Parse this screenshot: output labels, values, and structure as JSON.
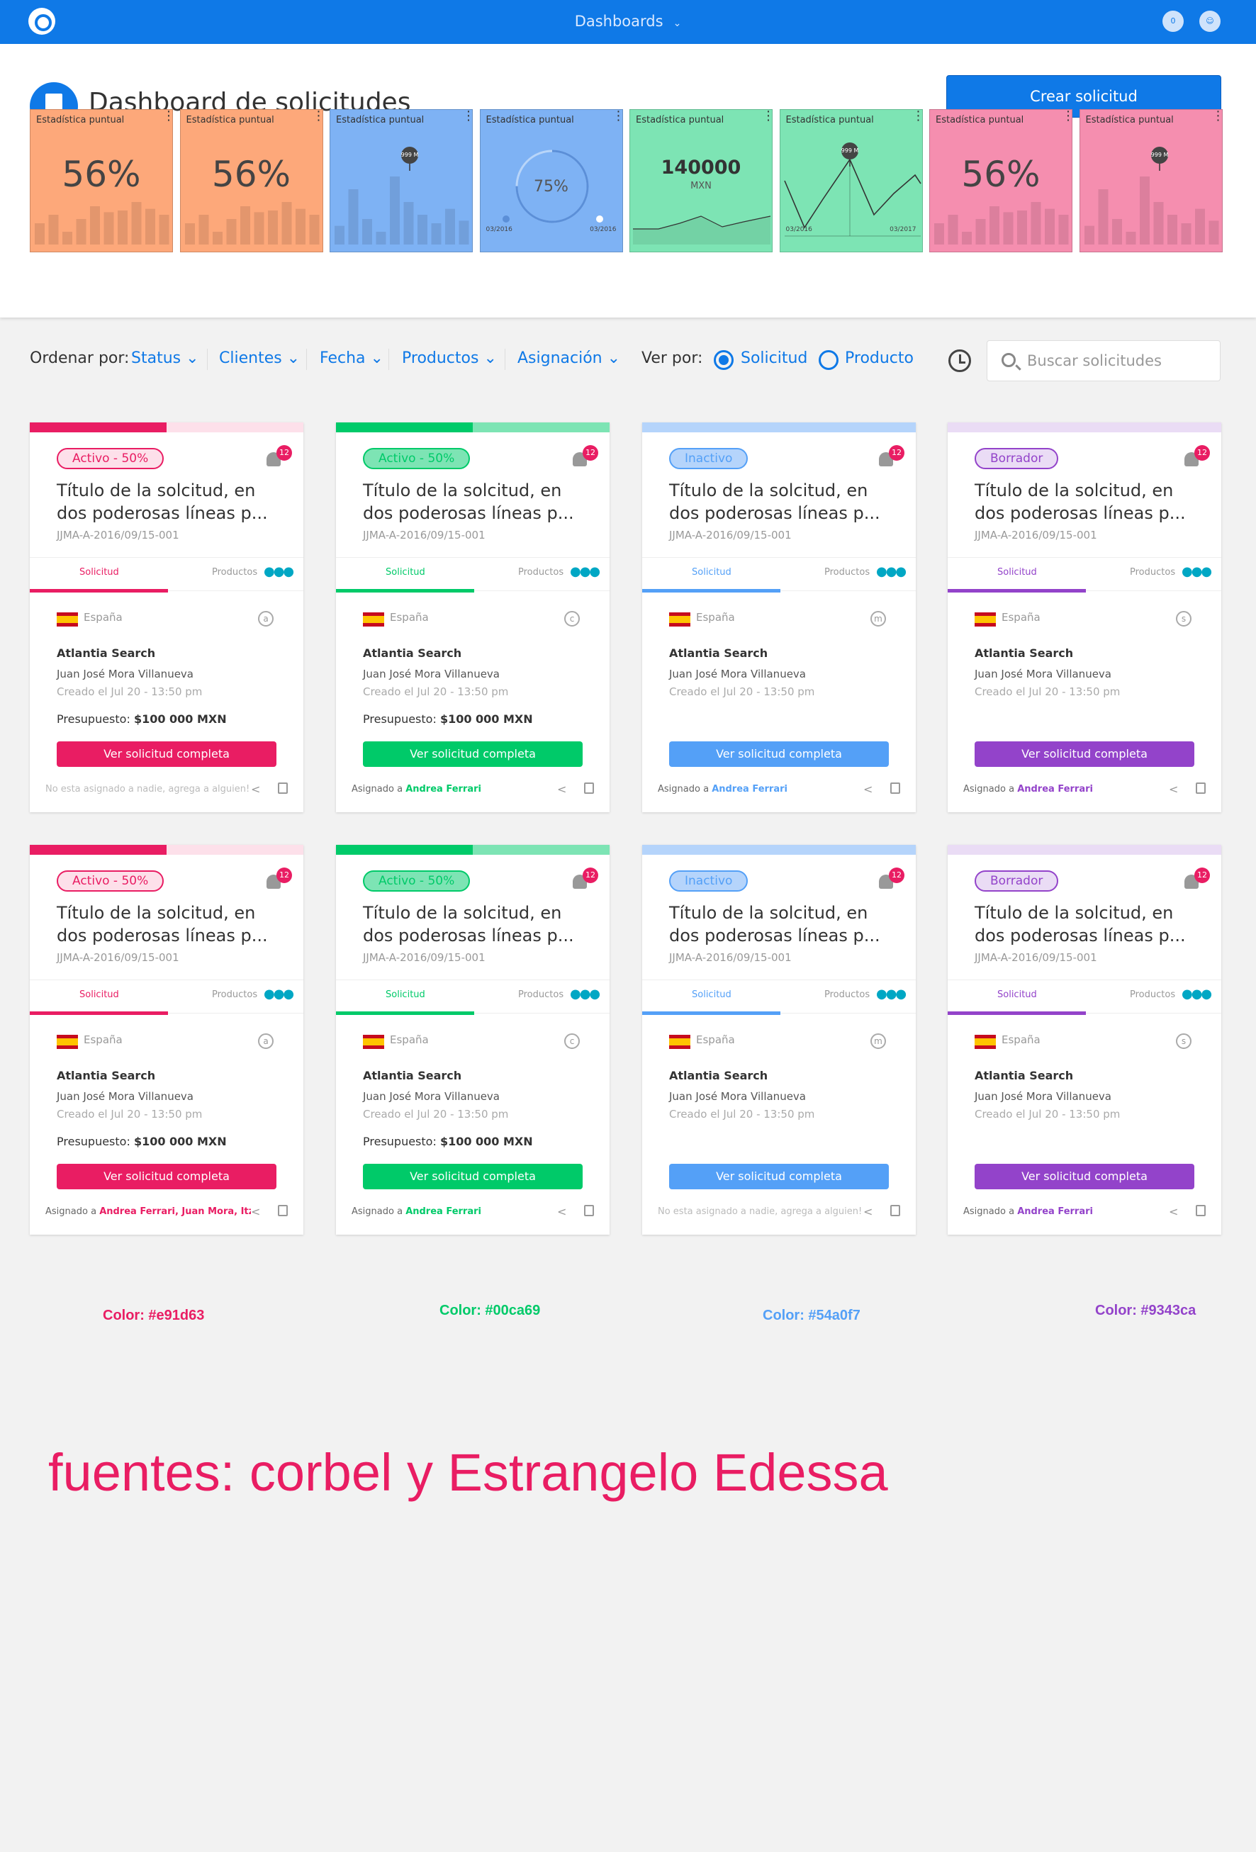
{
  "topbar": {
    "title": "Dashboards",
    "chat_badge": "0"
  },
  "header": {
    "title": "Dashboard de solicitudes",
    "create_label": "Crear solicitud"
  },
  "stats": [
    {
      "label": "Estadística puntual",
      "value": "56%",
      "color": "#fda87a",
      "bars": [
        0.25,
        0.35,
        0.15,
        0.3,
        0.45,
        0.38,
        0.4,
        0.5,
        0.42,
        0.35
      ]
    },
    {
      "label": "Estadística puntual",
      "value": "56%",
      "color": "#fda87a",
      "bars": [
        0.25,
        0.35,
        0.15,
        0.3,
        0.45,
        0.38,
        0.4,
        0.5,
        0.42,
        0.35
      ]
    },
    {
      "label": "Estadística puntual",
      "value": "",
      "color": "#7eb2f4",
      "bars": [
        0.22,
        0.65,
        0.3,
        0.15,
        0.8,
        0.5,
        0.35,
        0.25,
        0.42,
        0.28
      ],
      "marker": "999 M"
    },
    {
      "label": "Estadística puntual",
      "value": "75%",
      "color": "#7eb2f4",
      "date_start": "03/2016",
      "date_end": "03/2016",
      "progress": 0.75
    },
    {
      "label": "Estadística puntual",
      "value": "140000",
      "unit": "MXN",
      "color": "#7de4b4"
    },
    {
      "label": "Estadística puntual",
      "value": "",
      "color": "#7de4b4",
      "marker": "999 M",
      "date_start": "03/2016",
      "date_end": "03/2017"
    },
    {
      "label": "Estadística puntual",
      "value": "56%",
      "color": "#f58eaf",
      "bars": [
        0.25,
        0.35,
        0.15,
        0.3,
        0.45,
        0.38,
        0.4,
        0.5,
        0.42,
        0.35
      ]
    },
    {
      "label": "Estadística puntual",
      "value": "",
      "color": "#f58eaf",
      "bars": [
        0.22,
        0.65,
        0.3,
        0.15,
        0.8,
        0.5,
        0.35,
        0.25,
        0.42,
        0.28
      ],
      "marker": "999 M"
    }
  ],
  "filters": {
    "sort_label": "Ordenar por:",
    "sort_options": [
      "Status",
      "Clientes",
      "Fecha",
      "Productos",
      "Asignación"
    ],
    "view_label": "Ver por:",
    "view_options": [
      "Solicitud",
      "Producto"
    ],
    "search_placeholder": "Buscar solicitudes"
  },
  "cards": [
    {
      "status": "Activo - 50%",
      "color": "#e91d63",
      "light": "#fde0ea",
      "progress": 0.5,
      "notif": "12",
      "title": "Título de la solcitud, en dos poderosas líneas p...",
      "code": "JJMA-A-2016/09/15-001",
      "tab1": "Solicitud",
      "tab2": "Productos",
      "country": "España",
      "cicon": "a",
      "company": "Atlantia Search",
      "person": "Juan José Mora Villanueva",
      "created": "Creado el Jul 20 - 13:50 pm",
      "budget_label": "Presupuesto:",
      "budget": "$100 000 MXN",
      "cta": "Ver solicitud completa",
      "assign_prefix": "",
      "assign_name": "",
      "assign_empty": "No esta asignado a nadie, agrega a alguien!"
    },
    {
      "status": "Activo - 50%",
      "color": "#00ca69",
      "light": "#7de4b4",
      "progress": 0.5,
      "notif": "12",
      "title": "Título de la solcitud, en dos poderosas líneas p...",
      "code": "JJMA-A-2016/09/15-001",
      "tab1": "Solicitud",
      "tab2": "Productos",
      "country": "España",
      "cicon": "c",
      "company": "Atlantia Search",
      "person": "Juan José Mora Villanueva",
      "created": "Creado el Jul 20 - 13:50 pm",
      "budget_label": "Presupuesto:",
      "budget": "$100 000 MXN",
      "cta": "Ver solicitud completa",
      "assign_prefix": "Asignado a",
      "assign_name": "Andrea Ferrari",
      "assign_empty": ""
    },
    {
      "status": "Inactivo",
      "color": "#54a0f7",
      "light": "#b5d4fb",
      "progress": 0,
      "notif": "12",
      "title": "Título de la solcitud, en dos poderosas líneas p...",
      "code": "JJMA-A-2016/09/15-001",
      "tab1": "Solicitud",
      "tab2": "Productos",
      "country": "España",
      "cicon": "m",
      "company": "Atlantia Search",
      "person": "Juan José Mora Villanueva",
      "created": "Creado el Jul 20 - 13:50 pm",
      "budget_label": "",
      "budget": "",
      "cta": "Ver solicitud completa",
      "assign_prefix": "Asignado a",
      "assign_name": "Andrea Ferrari",
      "assign_empty": ""
    },
    {
      "status": "Borrador",
      "color": "#9343ca",
      "light": "#eadcf5",
      "progress": 0,
      "notif": "12",
      "title": "Título de la solcitud, en dos poderosas líneas p...",
      "code": "JJMA-A-2016/09/15-001",
      "tab1": "Solicitud",
      "tab2": "Productos",
      "country": "España",
      "cicon": "s",
      "company": "Atlantia Search",
      "person": "Juan José Mora Villanueva",
      "created": "Creado el Jul 20 - 13:50 pm",
      "budget_label": "",
      "budget": "",
      "cta": "Ver solicitud completa",
      "assign_prefix": "Asignado a",
      "assign_name": "Andrea Ferrari",
      "assign_empty": ""
    },
    {
      "status": "Activo - 50%",
      "color": "#e91d63",
      "light": "#fde0ea",
      "progress": 0.5,
      "notif": "12",
      "title": "Título de la solcitud, en dos poderosas líneas p...",
      "code": "JJMA-A-2016/09/15-001",
      "tab1": "Solicitud",
      "tab2": "Productos",
      "country": "España",
      "cicon": "a",
      "company": "Atlantia Search",
      "person": "Juan José Mora Villanueva",
      "created": "Creado el Jul 20 - 13:50 pm",
      "budget_label": "Presupuesto:",
      "budget": "$100 000 MXN",
      "cta": "Ver solicitud completa",
      "assign_prefix": "Asignado a",
      "assign_name": "Andrea Ferrari, Juan Mora, Itz...",
      "assign_empty": ""
    },
    {
      "status": "Activo - 50%",
      "color": "#00ca69",
      "light": "#7de4b4",
      "progress": 0.5,
      "notif": "12",
      "title": "Título de la solcitud, en dos poderosas líneas p...",
      "code": "JJMA-A-2016/09/15-001",
      "tab1": "Solicitud",
      "tab2": "Productos",
      "country": "España",
      "cicon": "c",
      "company": "Atlantia Search",
      "person": "Juan José Mora Villanueva",
      "created": "Creado el Jul 20 - 13:50 pm",
      "budget_label": "Presupuesto:",
      "budget": "$100 000 MXN",
      "cta": "Ver solicitud completa",
      "assign_prefix": "Asignado a",
      "assign_name": "Andrea Ferrari",
      "assign_empty": ""
    },
    {
      "status": "Inactivo",
      "color": "#54a0f7",
      "light": "#b5d4fb",
      "progress": 0,
      "notif": "12",
      "title": "Título de la solcitud, en dos poderosas líneas p...",
      "code": "JJMA-A-2016/09/15-001",
      "tab1": "Solicitud",
      "tab2": "Productos",
      "country": "España",
      "cicon": "m",
      "company": "Atlantia Search",
      "person": "Juan José Mora Villanueva",
      "created": "Creado el Jul 20 - 13:50 pm",
      "budget_label": "",
      "budget": "",
      "cta": "Ver solicitud completa",
      "assign_prefix": "",
      "assign_name": "",
      "assign_empty": "No esta asignado a nadie, agrega a alguien!"
    },
    {
      "status": "Borrador",
      "color": "#9343ca",
      "light": "#eadcf5",
      "progress": 0,
      "notif": "12",
      "title": "Título de la solcitud, en dos poderosas líneas p...",
      "code": "JJMA-A-2016/09/15-001",
      "tab1": "Solicitud",
      "tab2": "Productos",
      "country": "España",
      "cicon": "s",
      "company": "Atlantia Search",
      "person": "Juan José Mora Villanueva",
      "created": "Creado el Jul 20 - 13:50 pm",
      "budget_label": "",
      "budget": "",
      "cta": "Ver solicitud completa",
      "assign_prefix": "Asignado a",
      "assign_name": "Andrea Ferrari",
      "assign_empty": ""
    }
  ],
  "color_labels": [
    {
      "text": "Color: #e91d63",
      "color": "#e91d63"
    },
    {
      "text": "Color: #00ca69",
      "color": "#00ca69"
    },
    {
      "text": "Color: #54a0f7",
      "color": "#54a0f7"
    },
    {
      "text": "Color: #9343ca",
      "color": "#9343ca"
    }
  ],
  "fonts_note": "fuentes: corbel y Estrangelo Edessa"
}
